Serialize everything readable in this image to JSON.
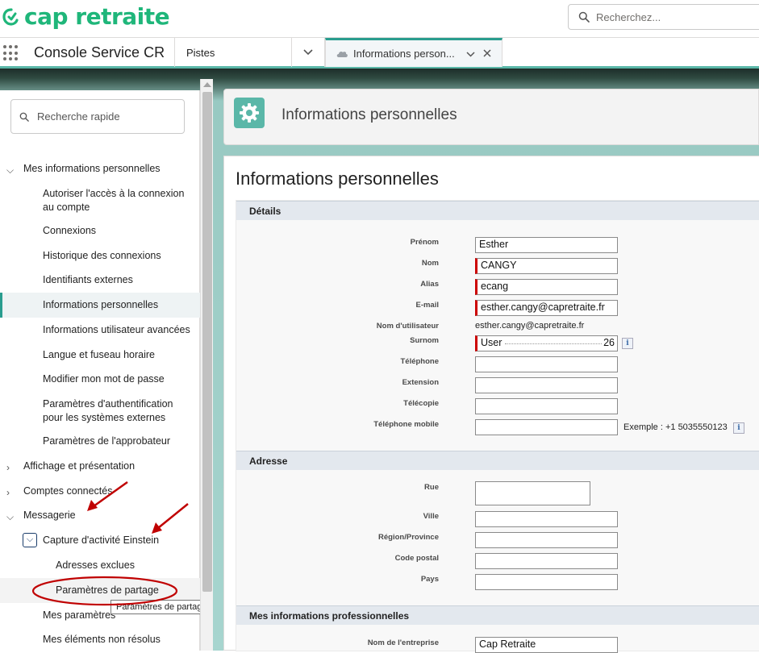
{
  "brand": {
    "name": "cap retraite",
    "color": "#1fb67a"
  },
  "global_search": {
    "placeholder": "Recherchez..."
  },
  "nav": {
    "app_name": "Console Service CR",
    "tabs": [
      {
        "label": "Pistes"
      },
      {
        "label": "Informations person..."
      }
    ]
  },
  "sidebar": {
    "quick_search_placeholder": "Recherche rapide",
    "sections": [
      {
        "label": "Mes informations personnelles",
        "expanded": true
      },
      {
        "label": "Affichage et présentation",
        "expanded": false
      },
      {
        "label": "Comptes connectés",
        "expanded": false
      },
      {
        "label": "Messagerie",
        "expanded": true
      }
    ],
    "items": [
      {
        "label": "Autoriser l'accès à la connexion au compte"
      },
      {
        "label": "Connexions"
      },
      {
        "label": "Historique des connexions"
      },
      {
        "label": "Identifiants externes"
      },
      {
        "label": "Informations personnelles",
        "active": true
      },
      {
        "label": "Informations utilisateur avancées"
      },
      {
        "label": "Langue et fuseau horaire"
      },
      {
        "label": "Modifier mon mot de passe"
      },
      {
        "label": "Paramètres d'authentification pour les systèmes externes"
      },
      {
        "label": "Paramètres de l'approbateur"
      }
    ],
    "messaging": {
      "einstein": "Capture d'activité Einstein",
      "excluded": "Adresses exclues",
      "sharing": "Paramètres de partage",
      "my_settings": "Mes paramètres",
      "unresolved": "Mes éléments non résolus"
    },
    "tooltip": "Paramètres de partage"
  },
  "page": {
    "header_title": "Informations personnelles",
    "title": "Informations personnelles",
    "accent_color": "#5ab7a8"
  },
  "form": {
    "details": {
      "heading": "Détails",
      "prenom": {
        "label": "Prénom",
        "value": "Esther"
      },
      "nom": {
        "label": "Nom",
        "value": "CANGY"
      },
      "alias": {
        "label": "Alias",
        "value": "ecang"
      },
      "email": {
        "label": "E-mail",
        "value": "esther.cangy@capretraite.fr"
      },
      "username": {
        "label": "Nom d'utilisateur",
        "value": "esther.cangy@capretraite.fr"
      },
      "surnom": {
        "label": "Surnom",
        "value_start": "User",
        "value_end": "26"
      },
      "telephone": {
        "label": "Téléphone",
        "value": ""
      },
      "extension": {
        "label": "Extension",
        "value": ""
      },
      "telecopie": {
        "label": "Télécopie",
        "value": ""
      },
      "mobile": {
        "label": "Téléphone mobile",
        "value": "",
        "hint": "Exemple : +1 5035550123"
      }
    },
    "address": {
      "heading": "Adresse",
      "rue": {
        "label": "Rue",
        "value": ""
      },
      "ville": {
        "label": "Ville",
        "value": ""
      },
      "region": {
        "label": "Région/Province",
        "value": ""
      },
      "code_postal": {
        "label": "Code postal",
        "value": ""
      },
      "pays": {
        "label": "Pays",
        "value": ""
      }
    },
    "professional": {
      "heading": "Mes informations professionnelles",
      "entreprise": {
        "label": "Nom de l'entreprise",
        "value": "Cap Retraite"
      }
    }
  },
  "icons": {
    "info": "i"
  }
}
